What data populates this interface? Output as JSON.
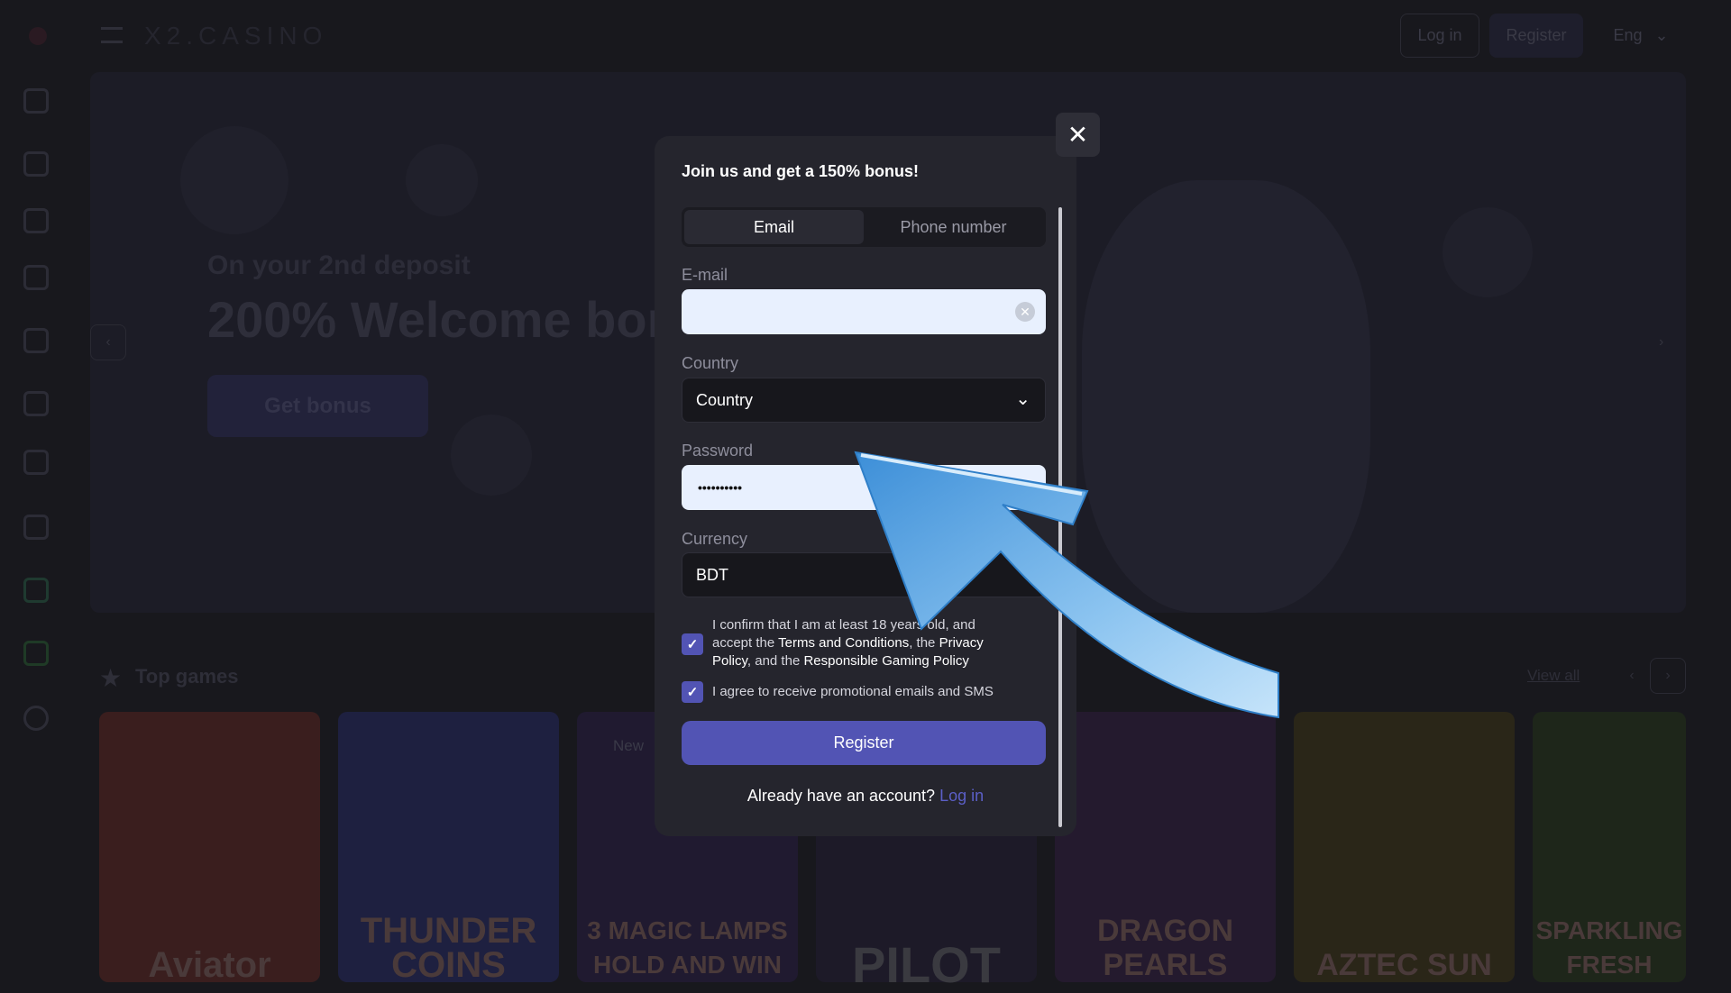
{
  "header": {
    "logo": "X2.CASINO",
    "login": "Log in",
    "register": "Register",
    "language": "Eng"
  },
  "sidebar": {
    "icons": [
      "rocket-icon",
      "slot-machine-icon",
      "dice-icon",
      "list-icon",
      "swords-icon",
      "gift-icon",
      "trophy-icon",
      "bell-icon",
      "globe-icon",
      "android-icon",
      "basketball-icon"
    ]
  },
  "banner": {
    "subtitle": "On your 2nd deposit",
    "title": "200% Welcome bonus",
    "button": "Get bonus"
  },
  "top_games": {
    "title": "Top games",
    "view_all": "View all",
    "games": [
      "Aviator",
      "THUNDER COINS",
      "3 MAGIC LAMPS HOLD AND WIN",
      "PILOT",
      "DRAGON PEARLS",
      "AZTEC SUN",
      "SPARKLING FRESH"
    ],
    "new_badge": "New"
  },
  "modal": {
    "title": "Join us and get a 150% bonus!",
    "tabs": [
      {
        "label": "Email",
        "active": true
      },
      {
        "label": "Phone number",
        "active": false
      }
    ],
    "email": {
      "label": "E-mail",
      "value": ""
    },
    "country": {
      "label": "Country",
      "value": "Country"
    },
    "password": {
      "label": "Password",
      "value": "••••••••••"
    },
    "currency": {
      "label": "Currency",
      "value": "BDT"
    },
    "confirm": {
      "text1": "I confirm that I am at least 18 years old, and accept the",
      "terms": "Terms and Conditions",
      "sep1": ", the ",
      "privacy": "Privacy Policy",
      "sep2": ", and the ",
      "responsible": "Responsible Gaming Policy",
      "checked": true
    },
    "promo": {
      "text": "I agree to receive promotional emails and SMS",
      "checked": true
    },
    "register": "Register",
    "already": "Already have an account?",
    "login_link": "Log in"
  },
  "colors": {
    "accent": "#5254b4",
    "link": "#5b5fc7",
    "arrow": "#4a9fe0"
  }
}
